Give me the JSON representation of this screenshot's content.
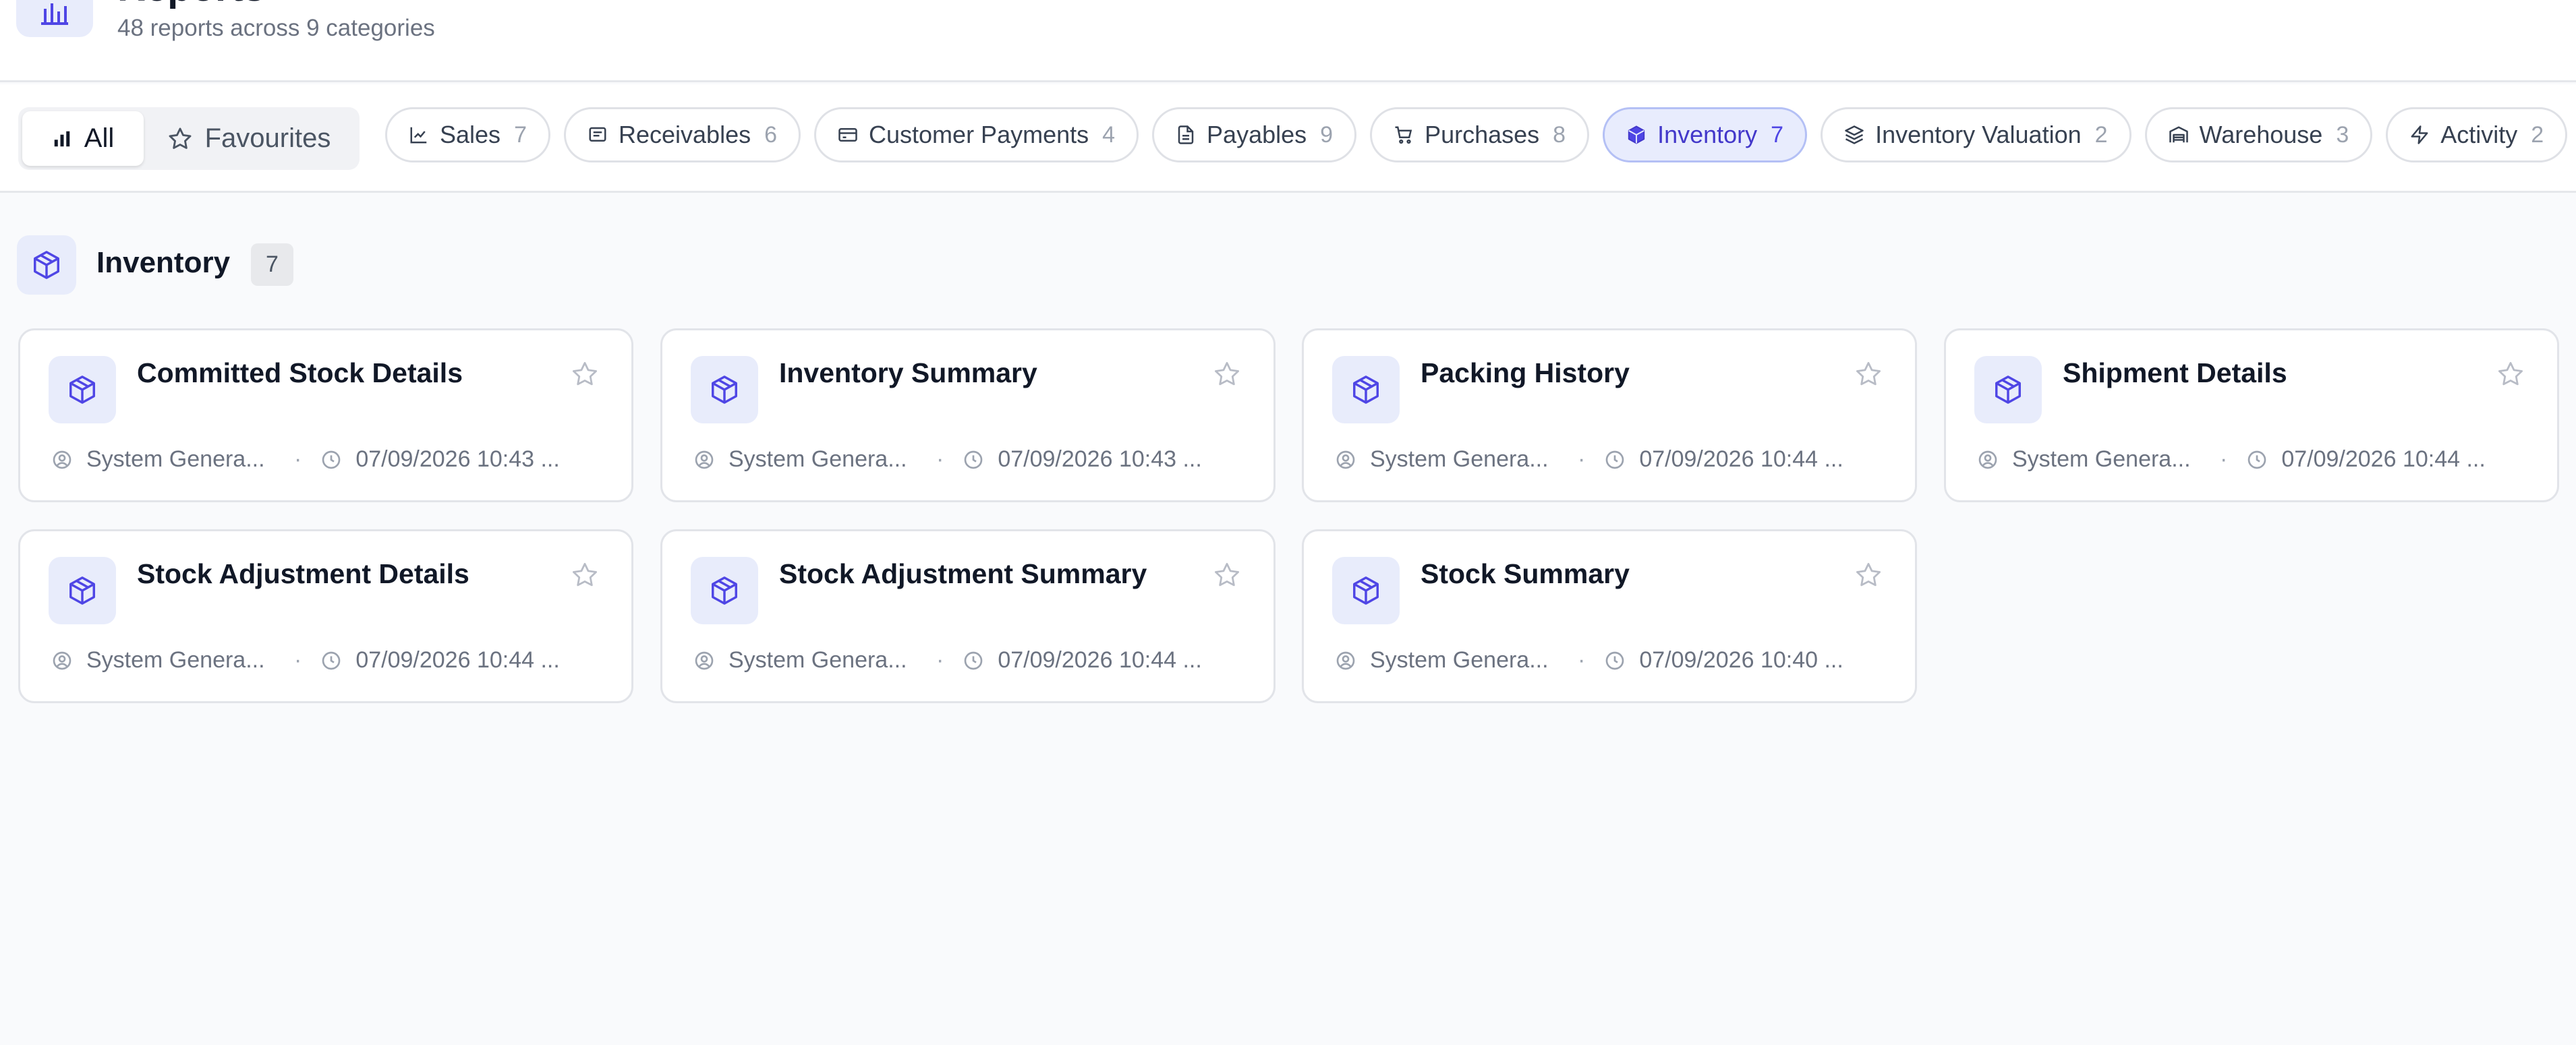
{
  "header": {
    "title": "Reports",
    "subtitle": "48 reports across 9 categories"
  },
  "view_toggle": {
    "all_label": "All",
    "favourites_label": "Favourites"
  },
  "categories": [
    {
      "label": "Sales",
      "count": "7",
      "icon": "trend-line-icon"
    },
    {
      "label": "Receivables",
      "count": "6",
      "icon": "message-square-icon"
    },
    {
      "label": "Customer Payments",
      "count": "4",
      "icon": "credit-card-icon"
    },
    {
      "label": "Payables",
      "count": "9",
      "icon": "file-text-icon"
    },
    {
      "label": "Purchases",
      "count": "8",
      "icon": "shopping-cart-icon"
    },
    {
      "label": "Inventory",
      "count": "7",
      "icon": "package-icon",
      "active": true
    },
    {
      "label": "Inventory Valuation",
      "count": "2",
      "icon": "layers-icon"
    },
    {
      "label": "Warehouse",
      "count": "3",
      "icon": "warehouse-icon"
    },
    {
      "label": "Activity",
      "count": "2",
      "icon": "zap-icon"
    }
  ],
  "section": {
    "title": "Inventory",
    "count": "7"
  },
  "reports": [
    {
      "title": "Committed Stock Details",
      "author": "System Genera...",
      "date": "07/09/2026 10:43 ..."
    },
    {
      "title": "Inventory Summary",
      "author": "System Genera...",
      "date": "07/09/2026 10:43 ..."
    },
    {
      "title": "Packing History",
      "author": "System Genera...",
      "date": "07/09/2026 10:44 ..."
    },
    {
      "title": "Shipment Details",
      "author": "System Genera...",
      "date": "07/09/2026 10:44 ..."
    },
    {
      "title": "Stock Adjustment Details",
      "author": "System Genera...",
      "date": "07/09/2026 10:44 ..."
    },
    {
      "title": "Stock Adjustment Summary",
      "author": "System Genera...",
      "date": "07/09/2026 10:44 ..."
    },
    {
      "title": "Stock Summary",
      "author": "System Genera...",
      "date": "07/09/2026 10:40 ..."
    }
  ],
  "colors": {
    "accent": "#4f46e5",
    "accent_bg": "#e8ecfd",
    "border": "#e2e4e9",
    "muted_text": "#6b7280"
  }
}
